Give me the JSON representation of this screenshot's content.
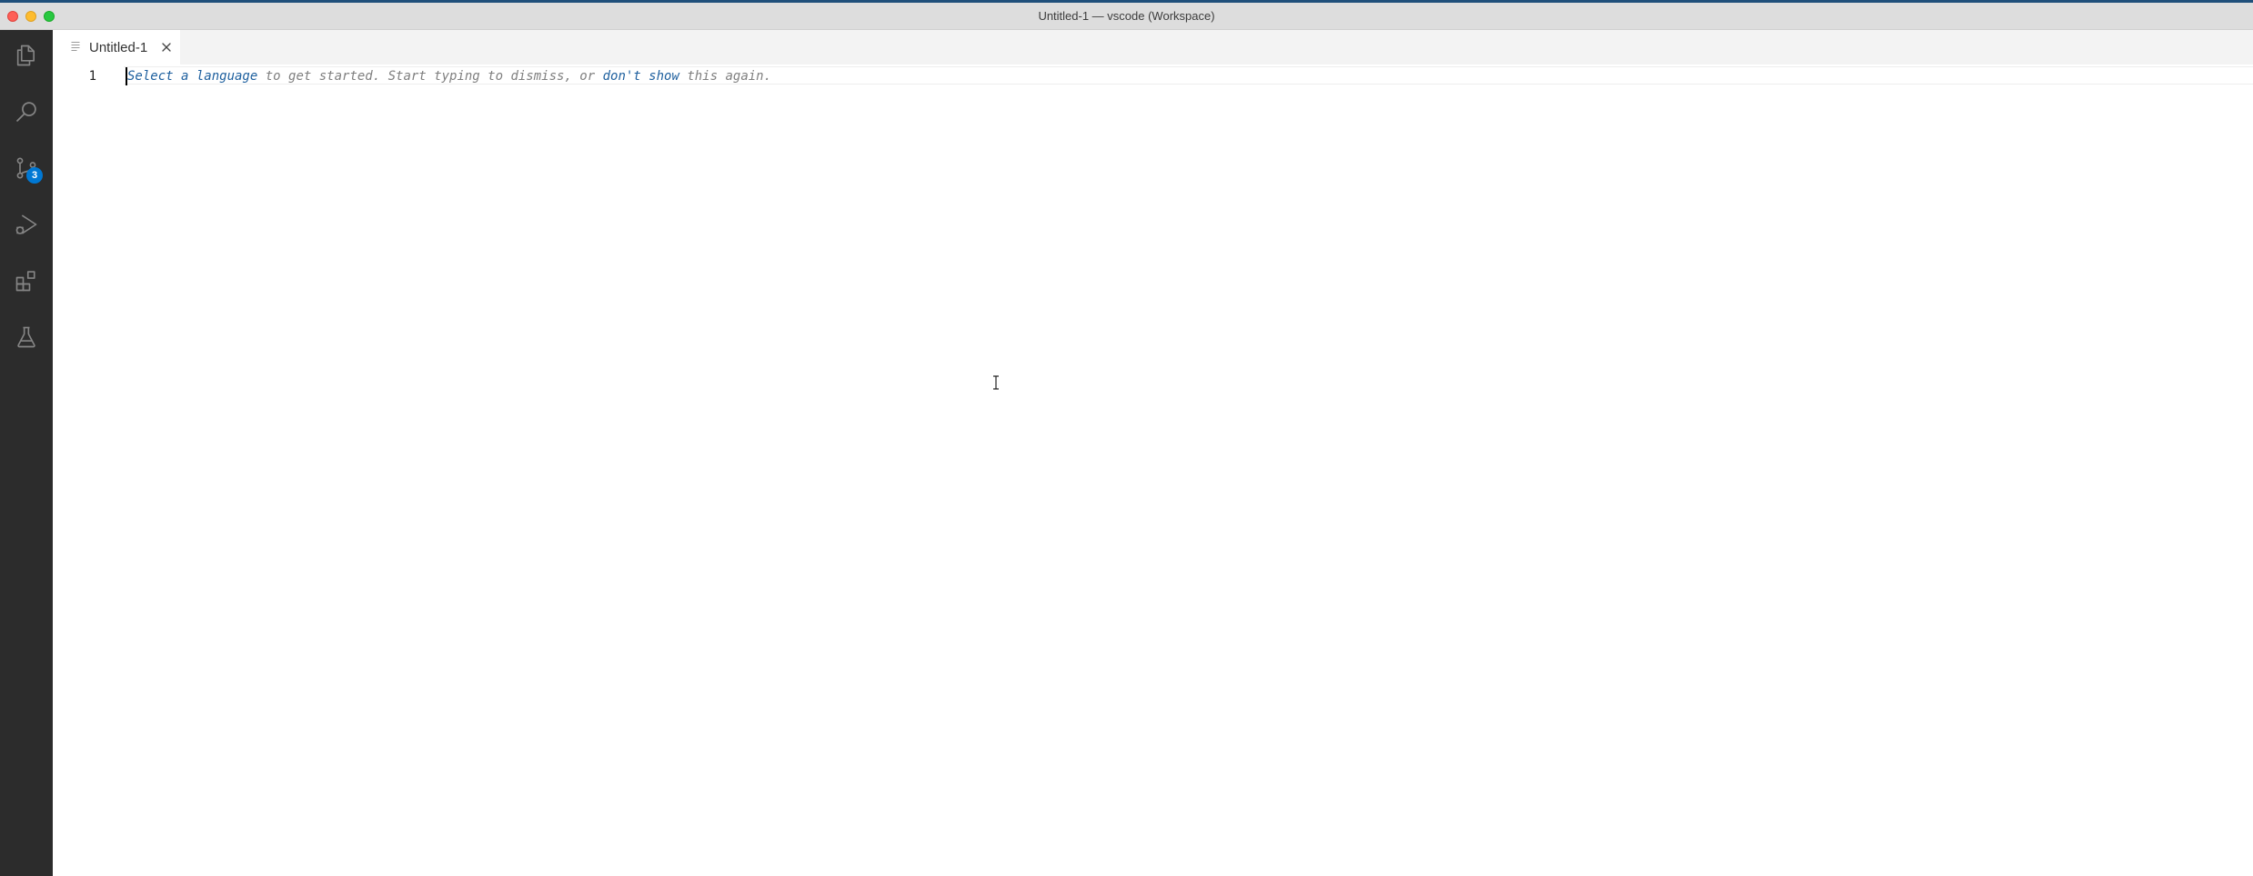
{
  "window": {
    "title": "Untitled-1 — vscode (Workspace)"
  },
  "activity_bar": {
    "items": [
      {
        "name": "explorer",
        "icon": "files-icon"
      },
      {
        "name": "search",
        "icon": "search-icon"
      },
      {
        "name": "source-control",
        "icon": "source-control-icon",
        "badge": "3"
      },
      {
        "name": "run-and-debug",
        "icon": "run-debug-icon"
      },
      {
        "name": "extensions",
        "icon": "extensions-icon"
      },
      {
        "name": "testing",
        "icon": "beaker-icon"
      }
    ],
    "colors": {
      "background": "#2c2c2c",
      "icon": "#858585",
      "badge": "#0078d4"
    }
  },
  "tabs": [
    {
      "label": "Untitled-1",
      "active": true
    }
  ],
  "editor": {
    "line_number": "1",
    "hint": {
      "link1": "Select a language",
      "text1": " to get started. Start typing to dismiss, or ",
      "link2": "don't show",
      "text2": " this again."
    }
  }
}
